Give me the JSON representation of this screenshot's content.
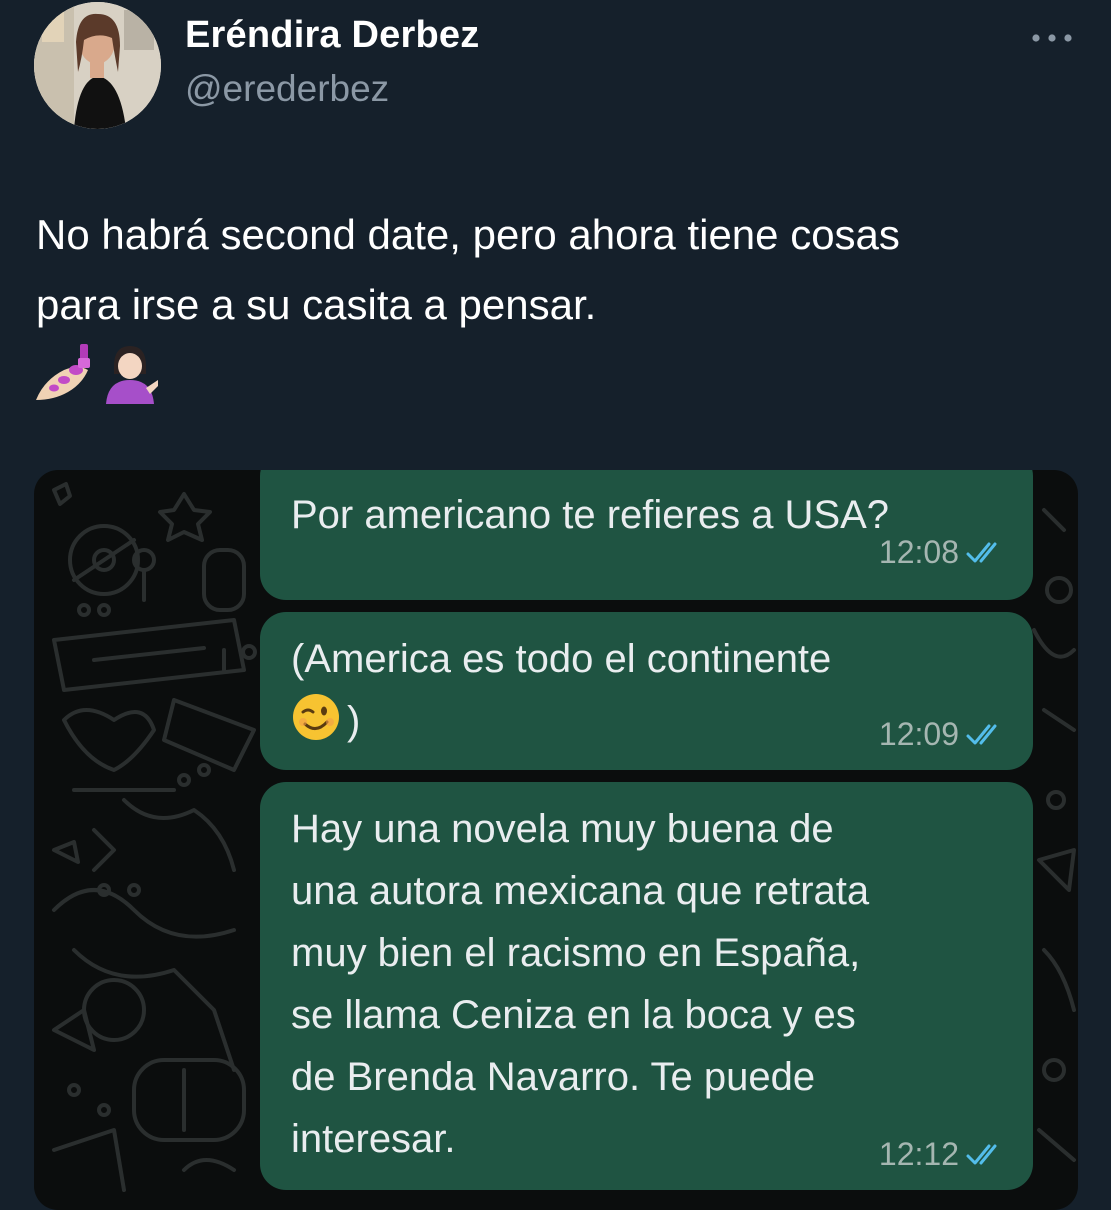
{
  "author": {
    "display_name": "Eréndira Derbez",
    "handle": "@erederbez",
    "avatar": "avatar-photo"
  },
  "more_icon": "ellipsis-icon",
  "tweet": {
    "text_line1": "No habrá second date, pero ahora tiene cosas",
    "text_line2": "para irse a su casita a pensar.",
    "emojis": [
      "nail-polish-emoji",
      "woman-tipping-hand-emoji"
    ]
  },
  "chat": {
    "read_receipt_color": "#53bdeb",
    "bubble_color": "#1f5442",
    "messages": [
      {
        "line1": "Por americano te refieres a USA?",
        "time": "12:08",
        "status_icon": "double-check-icon"
      },
      {
        "line1": "(America es todo el continente",
        "line2_emoji": "winking-face-emoji",
        "line2_text": ")",
        "time": "12:09",
        "status_icon": "double-check-icon"
      },
      {
        "line1": "Hay una novela muy buena de",
        "line2": "una autora mexicana que retrata",
        "line3": "muy bien el racismo en España,",
        "line4": "se llama Ceniza en la boca y es",
        "line5": "de Brenda Navarro. Te puede",
        "line6": "interesar.",
        "time": "12:12",
        "status_icon": "double-check-icon"
      }
    ]
  }
}
